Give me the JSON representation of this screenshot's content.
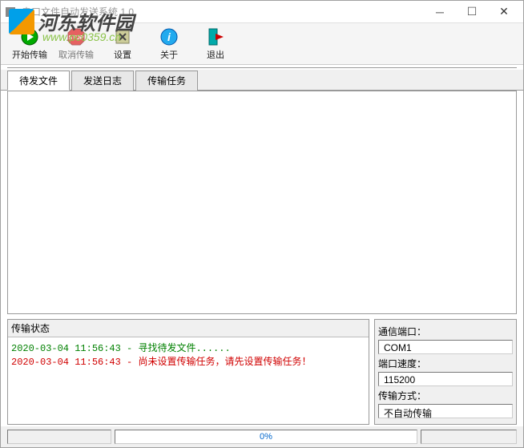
{
  "titlebar": {
    "title": "串口文件自动发送系统 1.0"
  },
  "watermark": {
    "name": "河东软件园",
    "url": "www.pc0359.cn"
  },
  "toolbar": {
    "start_label": "开始传输",
    "cancel_label": "取消传输",
    "settings_label": "设置",
    "about_label": "关于",
    "exit_label": "退出"
  },
  "tabs": {
    "pending_files": "待发文件",
    "send_log": "发送日志",
    "transfer_task": "传输任务"
  },
  "status": {
    "title": "传输状态",
    "lines": [
      {
        "ts": "2020-03-04 11:56:43",
        "sep": " - ",
        "msg": "寻找待发文件......",
        "cls": "green"
      },
      {
        "ts": "2020-03-04 11:56:43",
        "sep": " - ",
        "msg": "尚未设置传输任务，请先设置传输任务！",
        "cls": "red"
      }
    ]
  },
  "info": {
    "port_label": "通信端口：",
    "port_value": "COM1",
    "baud_label": "端口速度：",
    "baud_value": "115200",
    "mode_label": "传输方式：",
    "mode_value": "不自动传输"
  },
  "footer": {
    "progress": "0%"
  }
}
